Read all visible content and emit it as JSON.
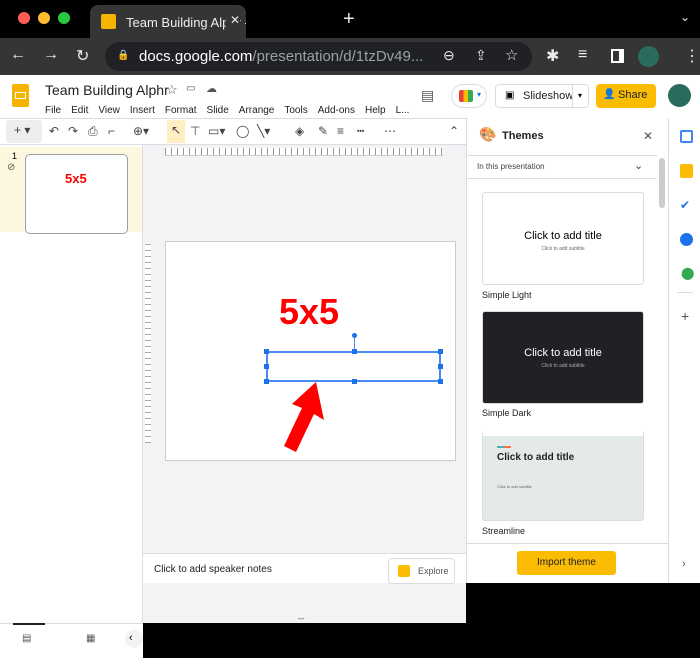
{
  "browser": {
    "tab_title": "Team Building Alphr - Google Slides",
    "url_host": "docs.google.com",
    "url_path": "/presentation/d/1tzDv49..."
  },
  "doc": {
    "title": "Team Building Alphr",
    "menu": [
      "File",
      "Edit",
      "View",
      "Insert",
      "Format",
      "Slide",
      "Arrange",
      "Tools",
      "Add-ons",
      "Help",
      "L..."
    ],
    "slideshow_label": "Slideshow",
    "share_label": "Share"
  },
  "filmstrip": {
    "slide_number": "1",
    "thumb_text": "5x5"
  },
  "slide": {
    "title_text": "5x5"
  },
  "notes": {
    "placeholder": "Click to add speaker notes",
    "explore_label": "Explore"
  },
  "themes": {
    "title": "Themes",
    "section": "In this presentation",
    "items": [
      {
        "name": "Simple Light",
        "title": "Click to add title",
        "subtitle": "Click to add subtitle"
      },
      {
        "name": "Simple Dark",
        "title": "Click to add title",
        "subtitle": "Click to add subtitle"
      },
      {
        "name": "Streamline",
        "title": "Click to add title",
        "subtitle": "Click to add subtitle"
      }
    ],
    "import_label": "Import theme"
  },
  "colors": {
    "accent": "#fbbc04",
    "red": "#ff0000",
    "selection": "#1a73e8"
  }
}
